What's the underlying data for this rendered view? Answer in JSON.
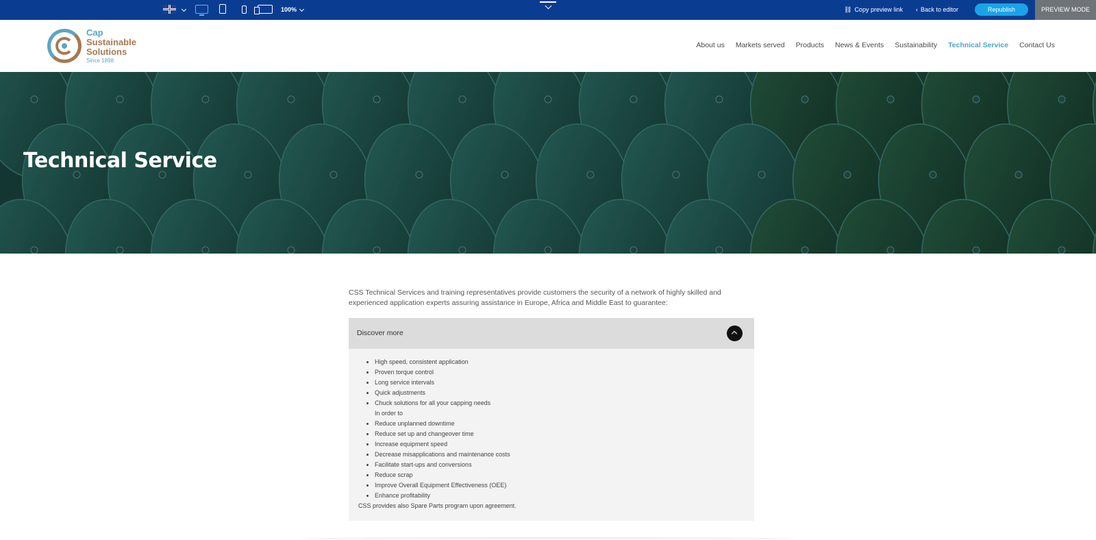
{
  "editor_bar": {
    "zoom": "100%",
    "copy_preview": "Copy preview link",
    "back_to_editor": "Back to editor",
    "republish": "Republish",
    "preview_mode": "PREVIEW MODE"
  },
  "logo": {
    "line1": "Cap",
    "line2": "Sustainable",
    "line3": "Solutions",
    "since": "Since 1898"
  },
  "nav": {
    "items": [
      "About us",
      "Markets served",
      "Products",
      "News & Events",
      "Sustainability",
      "Technical Service",
      "Contact Us"
    ],
    "active": "Technical Service"
  },
  "hero": {
    "title": "Technical Service"
  },
  "content": {
    "intro": "CSS Technical Services and training representatives provide customers the security of a network of highly skilled and experienced application experts assuring assistance in Europe, Africa and Middle East to guarantee:",
    "accordion": {
      "label": "Discover more",
      "items": [
        "High speed, consistent application",
        "Proven torque control",
        "Long service intervals",
        "Quick adjustments",
        "Chuck solutions for all your capping needs",
        "In order to",
        "Reduce unplanned downtime",
        "Reduce set up and changeover time",
        "Increase equipment speed",
        "Decrease misapplications and maintenance costs",
        "Facilitate start-ups and conversions",
        "Reduce scrap",
        "Improve Overall Equipment Effectiveness (OEE)",
        "Enhance profitability"
      ],
      "footer": "CSS provides also Spare Parts program upon agreement."
    }
  },
  "colors": {
    "editor_bar": "#0a3d91",
    "republish": "#1aa3e8",
    "nav_active": "#4aa8cc",
    "hero_base": "#1f4a45"
  }
}
